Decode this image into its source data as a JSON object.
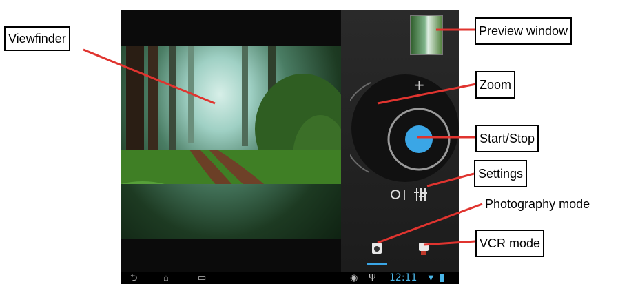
{
  "callouts": {
    "viewfinder": "Viewfinder",
    "preview_window": "Preview window",
    "zoom": "Zoom",
    "start_stop": "Start/Stop",
    "settings": "Settings",
    "photography_mode": "Photography mode",
    "vcr_mode": "VCR mode"
  },
  "camera": {
    "zoom_plus": "+",
    "status_time": "12:11"
  },
  "icons": {
    "back": "back-icon",
    "home": "home-icon",
    "recent": "recent-apps-icon",
    "shutter": "shutter-button",
    "settings": "settings-sliders-icon",
    "photo_mode": "camera-icon",
    "video_mode": "video-camera-icon",
    "wifi": "wifi-icon",
    "battery": "battery-icon",
    "usb": "usb-icon"
  },
  "colors": {
    "accent": "#3aa6e6",
    "panel": "#222222",
    "status_blue": "#4ab6e8"
  }
}
